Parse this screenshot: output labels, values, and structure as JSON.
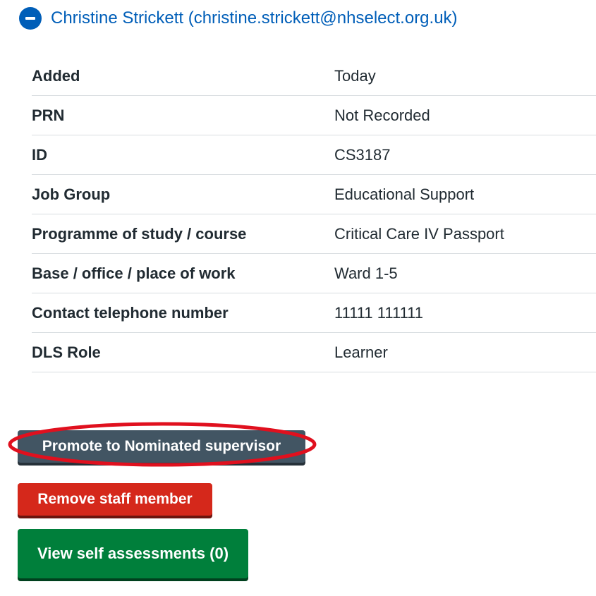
{
  "expander": {
    "summary": "Christine Strickett (christine.strickett@nhselect.org.uk)",
    "icon": "minus-icon"
  },
  "details": [
    {
      "key": "Added",
      "value": "Today"
    },
    {
      "key": "PRN",
      "value": "Not Recorded"
    },
    {
      "key": "ID",
      "value": "CS3187"
    },
    {
      "key": "Job Group",
      "value": "Educational Support"
    },
    {
      "key": "Programme of study / course",
      "value": "Critical Care IV Passport"
    },
    {
      "key": "Base / office / place of work",
      "value": "Ward 1-5"
    },
    {
      "key": "Contact telephone number",
      "value": "11111 111111"
    },
    {
      "key": "DLS Role",
      "value": "Learner"
    }
  ],
  "actions": {
    "promote_label": "Promote to Nominated supervisor",
    "remove_label": "Remove staff member",
    "view_label": "View self assessments (0)"
  },
  "colors": {
    "link_blue": "#005eb8",
    "secondary": "#425563",
    "warning": "#d5281b",
    "primary": "#007f3b",
    "annotation": "#e0101e"
  }
}
